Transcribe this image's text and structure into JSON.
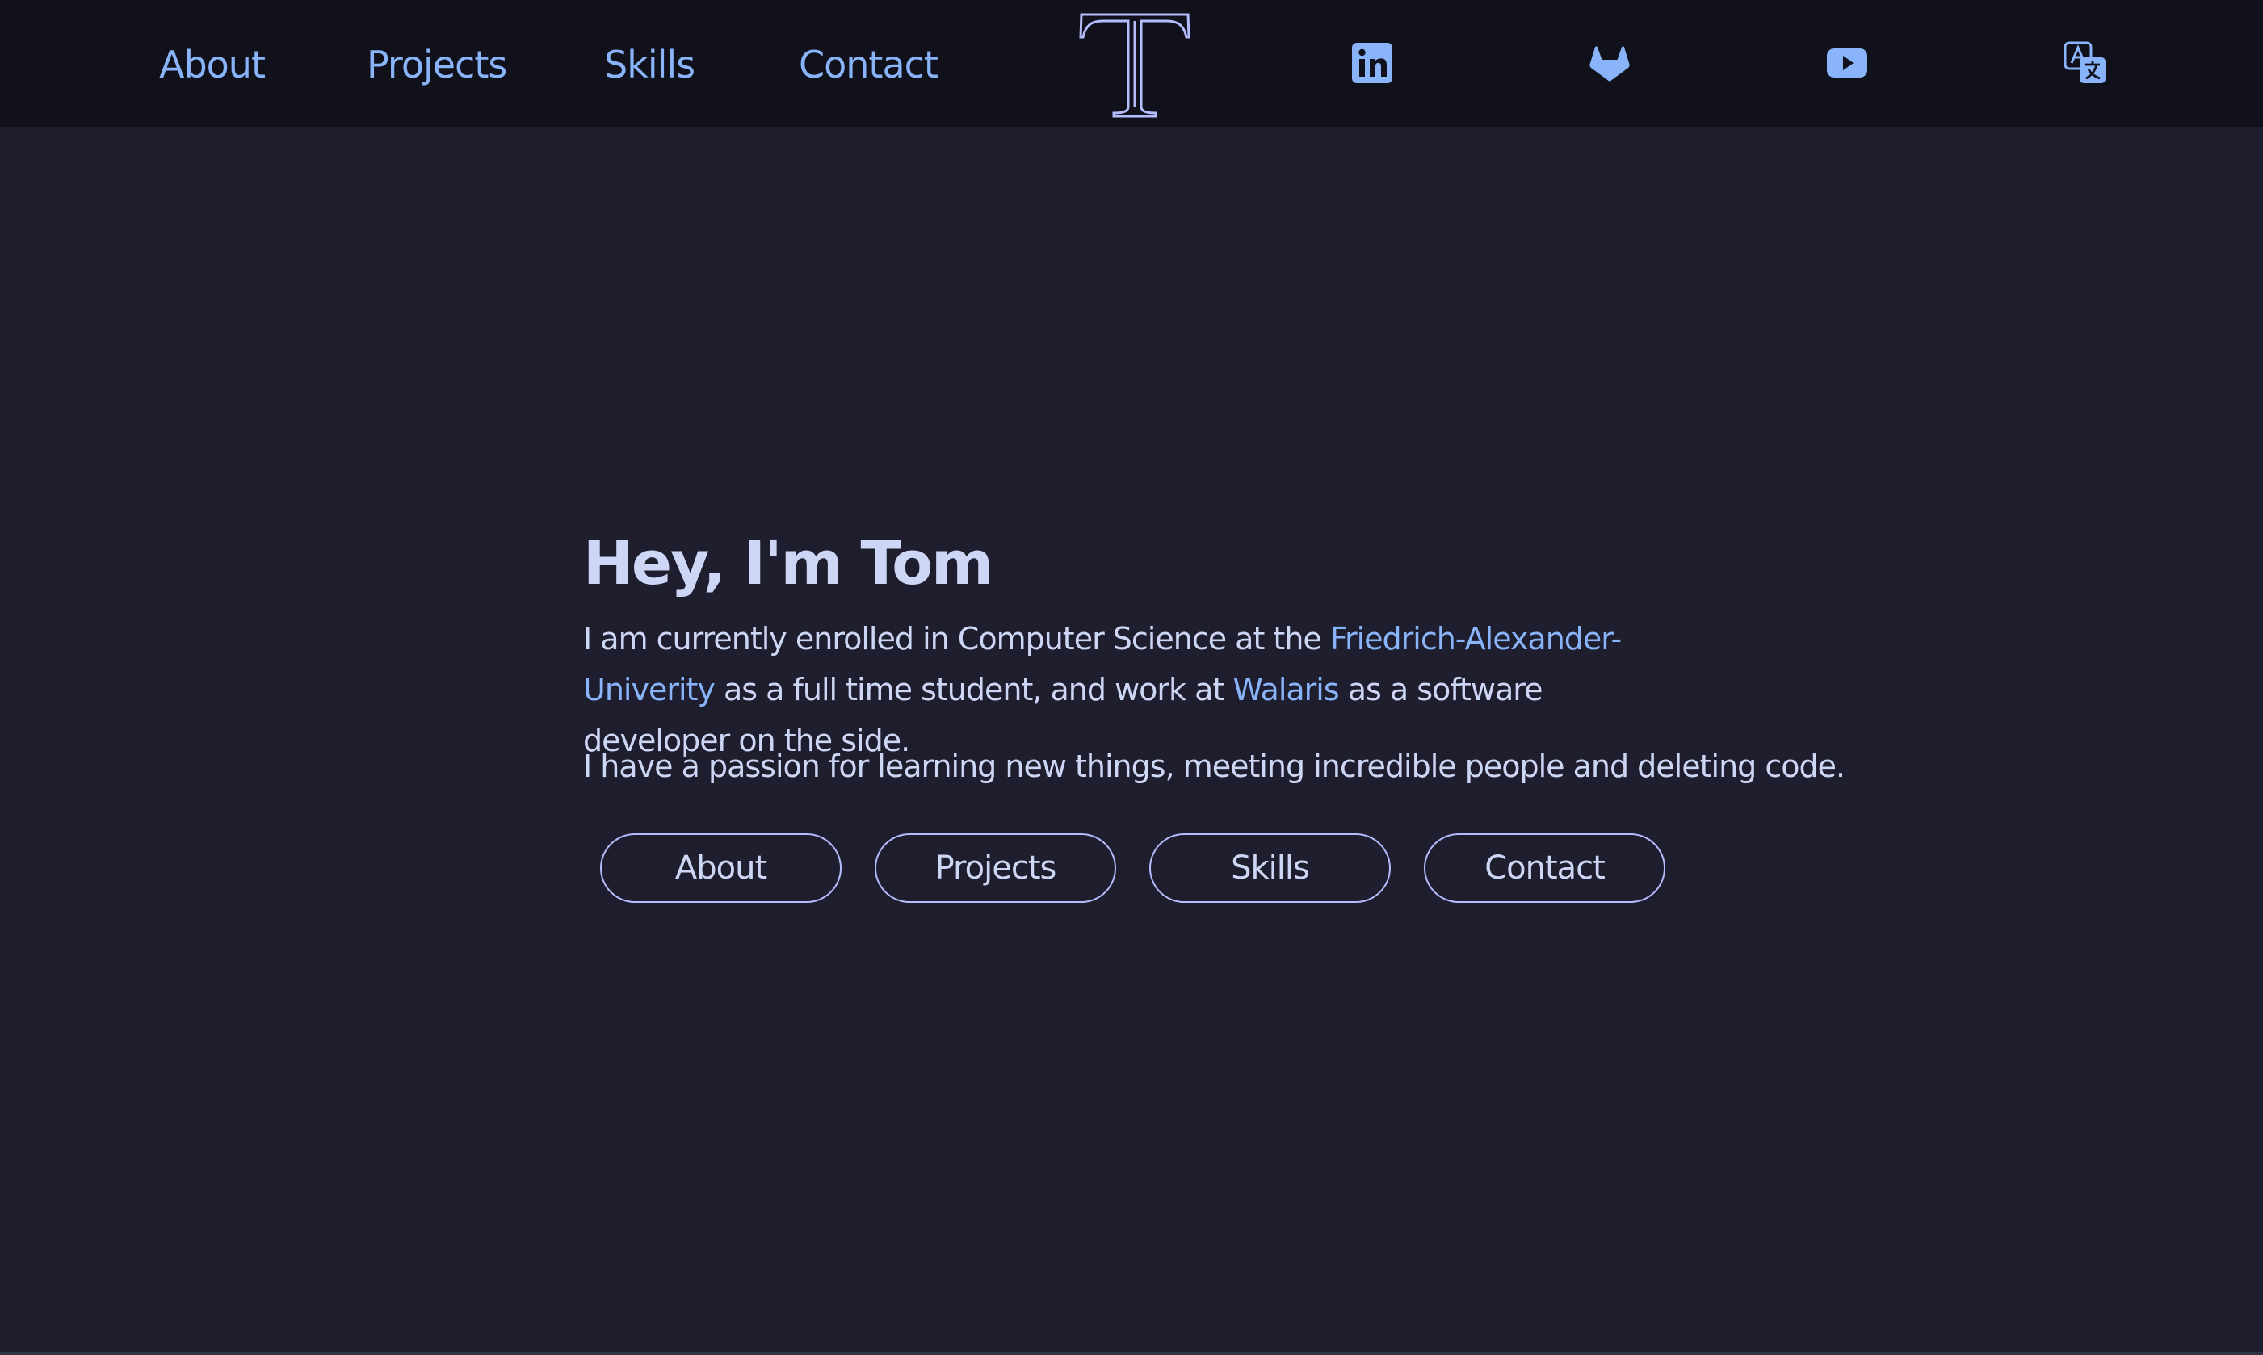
{
  "nav": {
    "links": [
      {
        "label": "About"
      },
      {
        "label": "Projects"
      },
      {
        "label": "Skills"
      },
      {
        "label": "Contact"
      }
    ],
    "logo_letter": "T",
    "social_icons": [
      "linkedin-icon",
      "gitlab-icon",
      "youtube-icon",
      "translate-icon"
    ]
  },
  "hero": {
    "heading": "Hey, I'm Tom",
    "intro_part1": "I am currently enrolled in Computer Science at the ",
    "university_link": "Friedrich-Alexander-Univerity",
    "intro_part2": " as a full time student, and work at ",
    "company_link": "Walaris",
    "intro_part3": " as a software developer on the side.",
    "passion": "I have a passion for learning new things, meeting incredible people and deleting code.",
    "buttons": [
      {
        "label": "About"
      },
      {
        "label": "Projects"
      },
      {
        "label": "Skills"
      },
      {
        "label": "Contact"
      }
    ]
  },
  "colors": {
    "accent": "#89b4fa",
    "logo": "#b4befe",
    "text": "#cdd6f4",
    "background": "#1e1e2e",
    "navbar": "#11111b"
  }
}
